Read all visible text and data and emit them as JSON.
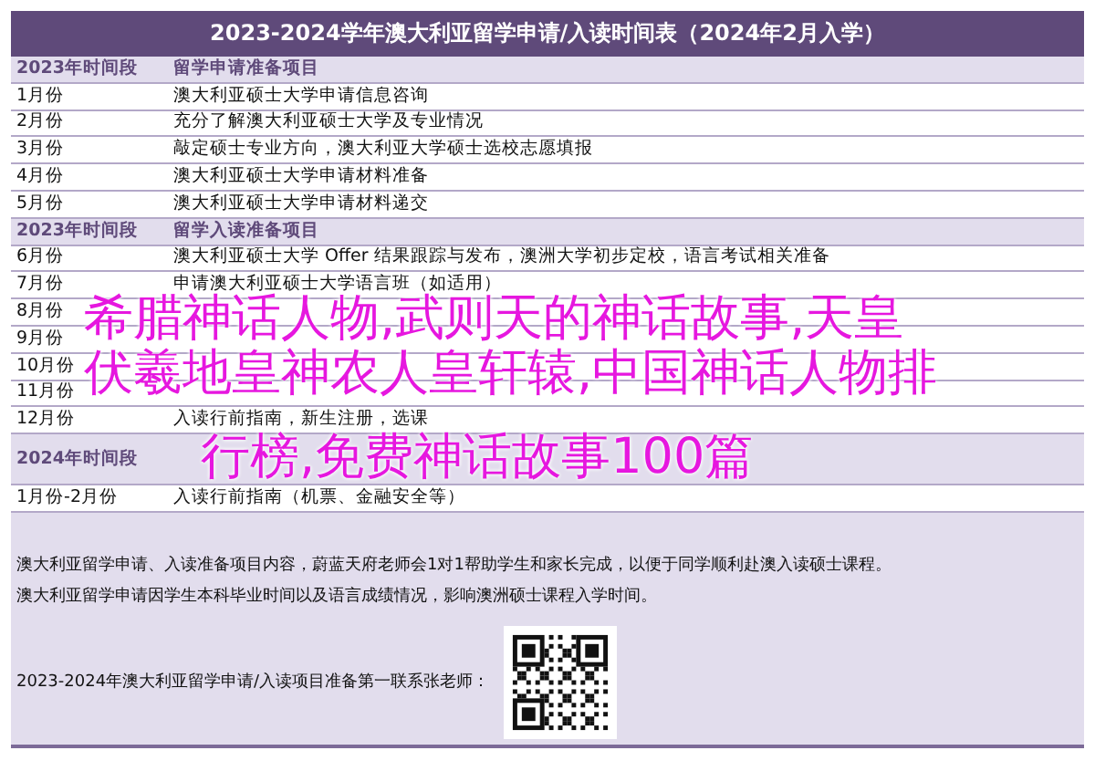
{
  "table": {
    "title": "2023-2024学年澳大利亚留学申请/入读时间表（2024年2月入学）",
    "rows": [
      {
        "kind": "section",
        "period": "2023年时间段",
        "item": "留学申请准备项目"
      },
      {
        "kind": "row",
        "period": "1月份",
        "item": "澳大利亚硕士大学申请信息咨询"
      },
      {
        "kind": "row",
        "period": "2月份",
        "item": "充分了解澳大利亚硕士大学及专业情况"
      },
      {
        "kind": "row",
        "period": "3月份",
        "item": "敲定硕士专业方向，澳大利亚大学硕士选校志愿填报"
      },
      {
        "kind": "row",
        "period": "4月份",
        "item": "澳大利亚硕士大学申请材料准备"
      },
      {
        "kind": "row",
        "period": "5月份",
        "item": "澳大利亚硕士大学申请材料递交"
      },
      {
        "kind": "section",
        "period": "2023年时间段",
        "item": "留学入读准备项目"
      },
      {
        "kind": "row",
        "period": "6月份",
        "item": "澳大利亚硕士大学 Offer 结果跟踪与发布，澳洲大学初步定校，语言考试相关准备"
      },
      {
        "kind": "row",
        "period": "7月份",
        "item": "申请澳大利亚硕士大学语言班（如适用）"
      },
      {
        "kind": "row",
        "period": "8月份"
      },
      {
        "kind": "row",
        "period": "9月份"
      },
      {
        "kind": "row",
        "period": "10月份"
      },
      {
        "kind": "row",
        "period": "11月份"
      },
      {
        "kind": "row",
        "period": "12月份",
        "item": "入读行前指南，新生注册，选课"
      },
      {
        "kind": "section",
        "period": "2024年时间段"
      },
      {
        "kind": "row",
        "period": "1月份-2月份",
        "item": "入读行前指南（机票、金融安全等）"
      }
    ],
    "notes": [
      "澳大利亚留学申请、入读准备项目内容，蔚蓝天府老师会1对1帮助学生和家长完成，以便于同学顺利赴澳入读硕士课程。",
      "澳大利亚留学申请因学生本科毕业时间以及语言成绩情况，影响澳洲硕士课程入学时间。"
    ],
    "contact": "2023-2024年澳大利亚留学申请/入读项目准备第一联系张老师："
  },
  "overlay_headline": [
    "希腊神话人物,武则天的神话故事,天皇",
    "伏羲地皇神农人皇轩辕,中国神话人物排",
    "行榜,免费神话故事100篇"
  ]
}
